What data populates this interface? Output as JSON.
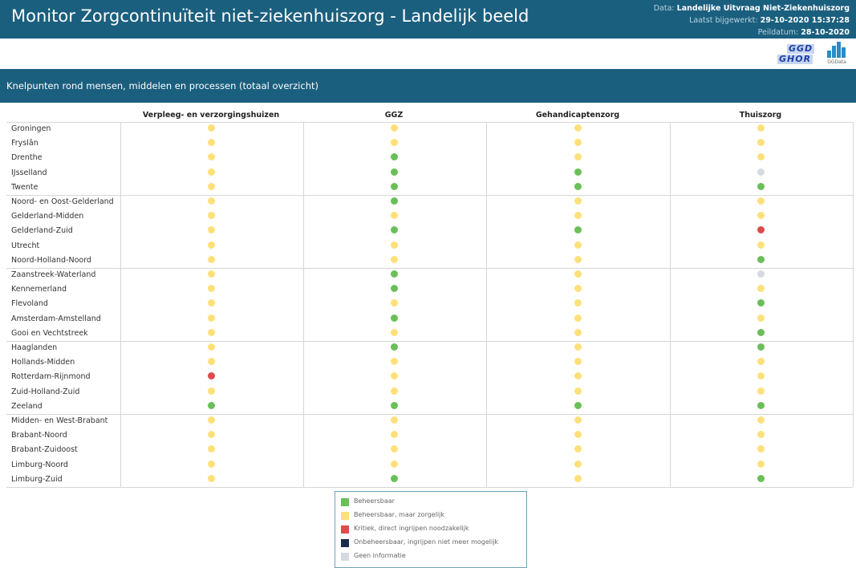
{
  "header": {
    "title": "Monitor Zorgcontinuïteit niet-ziekenhuiszorg - Landelijk beeld",
    "data_label": "Data:",
    "data_value": "Landelijke Uitvraag Niet-Ziekenhuiszorg",
    "updated_label": "Laatst bijgewerkt:",
    "updated_value": "29-10-2020 15:37:28",
    "peildatum_label": "Peildatum:",
    "peildatum_value": "28-10-2020"
  },
  "logos": {
    "ggd_line1": "GGD",
    "ggd_line2": "GHOR",
    "ggdata": "GGData"
  },
  "section": {
    "title": "Knelpunten rond mensen, middelen en processen (totaal overzicht)"
  },
  "columns": [
    "Verpleeg- en verzorgingshuizen",
    "GGZ",
    "Gehandicaptenzorg",
    "Thuiszorg"
  ],
  "status_colors": {
    "B": "#6bbf59",
    "Z": "#fde07a",
    "K": "#de4b4b",
    "O": "#1a2a4f",
    "G": "#d6d9e0"
  },
  "rows": [
    {
      "region": "Groningen",
      "status": [
        "Z",
        "Z",
        "Z",
        "Z"
      ]
    },
    {
      "region": "Fryslân",
      "status": [
        "Z",
        "Z",
        "Z",
        "Z"
      ]
    },
    {
      "region": "Drenthe",
      "status": [
        "Z",
        "B",
        "Z",
        "Z"
      ]
    },
    {
      "region": "IJsselland",
      "status": [
        "Z",
        "B",
        "B",
        "G"
      ]
    },
    {
      "region": "Twente",
      "status": [
        "Z",
        "B",
        "B",
        "B"
      ]
    },
    {
      "region": "Noord- en Oost-Gelderland",
      "status": [
        "Z",
        "B",
        "Z",
        "Z"
      ]
    },
    {
      "region": "Gelderland-Midden",
      "status": [
        "Z",
        "Z",
        "Z",
        "Z"
      ]
    },
    {
      "region": "Gelderland-Zuid",
      "status": [
        "Z",
        "B",
        "B",
        "K"
      ]
    },
    {
      "region": "Utrecht",
      "status": [
        "Z",
        "Z",
        "Z",
        "Z"
      ]
    },
    {
      "region": "Noord-Holland-Noord",
      "status": [
        "Z",
        "Z",
        "Z",
        "B"
      ]
    },
    {
      "region": "Zaanstreek-Waterland",
      "status": [
        "Z",
        "B",
        "Z",
        "G"
      ]
    },
    {
      "region": "Kennemerland",
      "status": [
        "Z",
        "B",
        "Z",
        "Z"
      ]
    },
    {
      "region": "Flevoland",
      "status": [
        "Z",
        "Z",
        "Z",
        "B"
      ]
    },
    {
      "region": "Amsterdam-Amstelland",
      "status": [
        "Z",
        "B",
        "Z",
        "Z"
      ]
    },
    {
      "region": "Gooi en Vechtstreek",
      "status": [
        "Z",
        "Z",
        "Z",
        "B"
      ]
    },
    {
      "region": "Haaglanden",
      "status": [
        "Z",
        "B",
        "Z",
        "B"
      ]
    },
    {
      "region": "Hollands-Midden",
      "status": [
        "Z",
        "Z",
        "Z",
        "Z"
      ]
    },
    {
      "region": "Rotterdam-Rijnmond",
      "status": [
        "K",
        "Z",
        "Z",
        "Z"
      ]
    },
    {
      "region": "Zuid-Holland-Zuid",
      "status": [
        "Z",
        "Z",
        "Z",
        "Z"
      ]
    },
    {
      "region": "Zeeland",
      "status": [
        "B",
        "B",
        "B",
        "B"
      ]
    },
    {
      "region": "Midden- en West-Brabant",
      "status": [
        "Z",
        "Z",
        "Z",
        "Z"
      ]
    },
    {
      "region": "Brabant-Noord",
      "status": [
        "Z",
        "Z",
        "Z",
        "Z"
      ]
    },
    {
      "region": "Brabant-Zuidoost",
      "status": [
        "Z",
        "Z",
        "Z",
        "Z"
      ]
    },
    {
      "region": "Limburg-Noord",
      "status": [
        "Z",
        "Z",
        "Z",
        "Z"
      ]
    },
    {
      "region": "Limburg-Zuid",
      "status": [
        "Z",
        "B",
        "Z",
        "B"
      ]
    }
  ],
  "legend": [
    {
      "code": "B",
      "label": "Beheersbaar"
    },
    {
      "code": "Z",
      "label": "Beheersbaar, maar zorgelijk"
    },
    {
      "code": "K",
      "label": "Kritiek, direct ingrijpen noodzakelijk"
    },
    {
      "code": "O",
      "label": "Onbeheersbaar, ingrijpen niet meer mogelijk"
    },
    {
      "code": "G",
      "label": "Geen informatie"
    }
  ]
}
